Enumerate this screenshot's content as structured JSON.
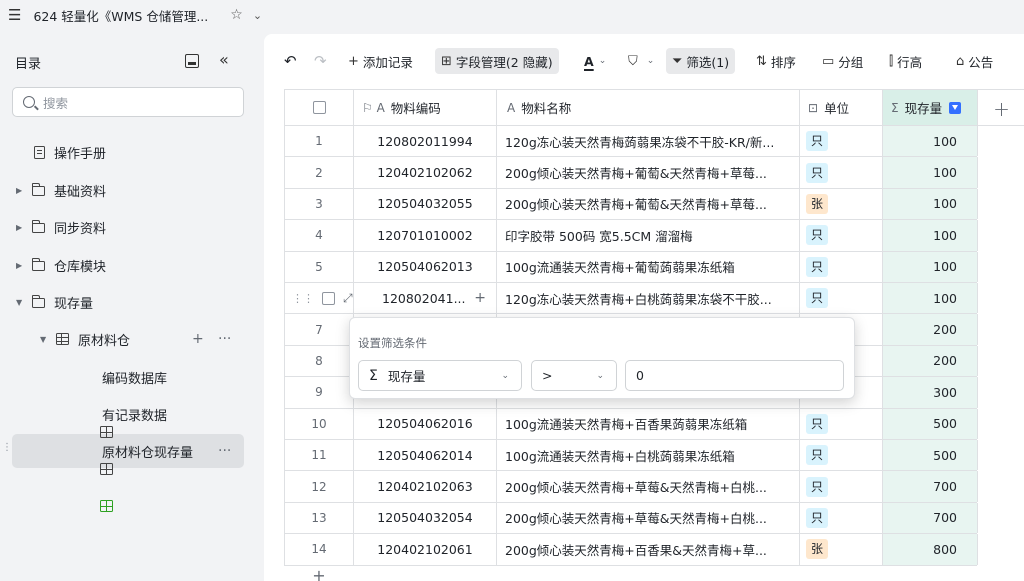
{
  "topbar": {
    "menu_icon": "☰",
    "doc_title": "624 轻量化《WMS 仓储管理...",
    "star": "☆",
    "chevron": "⌄"
  },
  "sidebar": {
    "title": "目录",
    "search_placeholder": "搜索",
    "items": [
      {
        "label": "操作手册"
      },
      {
        "label": "基础资料"
      },
      {
        "label": "同步资料"
      },
      {
        "label": "仓库模块"
      },
      {
        "label": "现存量"
      },
      {
        "label": "原材料仓"
      },
      {
        "label": "编码数据库"
      },
      {
        "label": "有记录数据"
      },
      {
        "label": "原材料仓现存量"
      }
    ]
  },
  "toolbar": {
    "undo": "↶",
    "redo": "↷",
    "add_record": "添加记录",
    "field_manage": "字段管理(2 隐藏)",
    "filter": "筛选(1)",
    "sort": "排序",
    "group": "分组",
    "row_height": "行高",
    "notice": "公告"
  },
  "grid": {
    "columns": [
      "物料编码",
      "物料名称",
      "单位",
      "现存量"
    ],
    "rows": [
      {
        "idx": "1",
        "code": "120802011994",
        "name": "120g冻心装天然青梅蒟蒻果冻袋不干胶-KR/新...",
        "unit": "只",
        "qty": "100"
      },
      {
        "idx": "2",
        "code": "120402102062",
        "name": "200g倾心装天然青梅+葡萄&天然青梅+草莓...",
        "unit": "只",
        "qty": "100"
      },
      {
        "idx": "3",
        "code": "120504032055",
        "name": "200g倾心装天然青梅+葡萄&天然青梅+草莓...",
        "unit": "张",
        "qty": "100"
      },
      {
        "idx": "4",
        "code": "120701010002",
        "name": "印字胶带 500码 宽5.5CM 溜溜梅",
        "unit": "只",
        "qty": "100"
      },
      {
        "idx": "5",
        "code": "120504062013",
        "name": "100g流通装天然青梅+葡萄蒟蒻果冻纸箱",
        "unit": "只",
        "qty": "100"
      },
      {
        "idx": "",
        "code": "120802041...",
        "name": "120g冻心装天然青梅+白桃蒟蒻果冻袋不干胶...",
        "unit": "只",
        "qty": "100"
      },
      {
        "idx": "7",
        "code": "",
        "name": "",
        "unit": "",
        "qty": "200"
      },
      {
        "idx": "8",
        "code": "",
        "name": "",
        "unit": "",
        "qty": "200"
      },
      {
        "idx": "9",
        "code": "",
        "name": "",
        "unit": "",
        "qty": "300"
      },
      {
        "idx": "10",
        "code": "120504062016",
        "name": "100g流通装天然青梅+百香果蒟蒻果冻纸箱",
        "unit": "只",
        "qty": "500"
      },
      {
        "idx": "11",
        "code": "120504062014",
        "name": "100g流通装天然青梅+白桃蒟蒻果冻纸箱",
        "unit": "只",
        "qty": "500"
      },
      {
        "idx": "12",
        "code": "120402102063",
        "name": "200g倾心装天然青梅+草莓&天然青梅+白桃...",
        "unit": "只",
        "qty": "700"
      },
      {
        "idx": "13",
        "code": "120504032054",
        "name": "200g倾心装天然青梅+草莓&天然青梅+白桃...",
        "unit": "只",
        "qty": "700"
      },
      {
        "idx": "14",
        "code": "120402102061",
        "name": "200g倾心装天然青梅+百香果&天然青梅+草...",
        "unit": "张",
        "qty": "800"
      }
    ]
  },
  "filter_popup": {
    "title": "设置筛选条件",
    "field": "现存量",
    "operator": ">",
    "value": "0"
  },
  "colors": {
    "accent": "#3370ff",
    "qty_bg": "#e8f5f1",
    "tag_blue": "#d9f3fd",
    "tag_orange": "#fee7cd",
    "active_green": "#2ea121"
  }
}
